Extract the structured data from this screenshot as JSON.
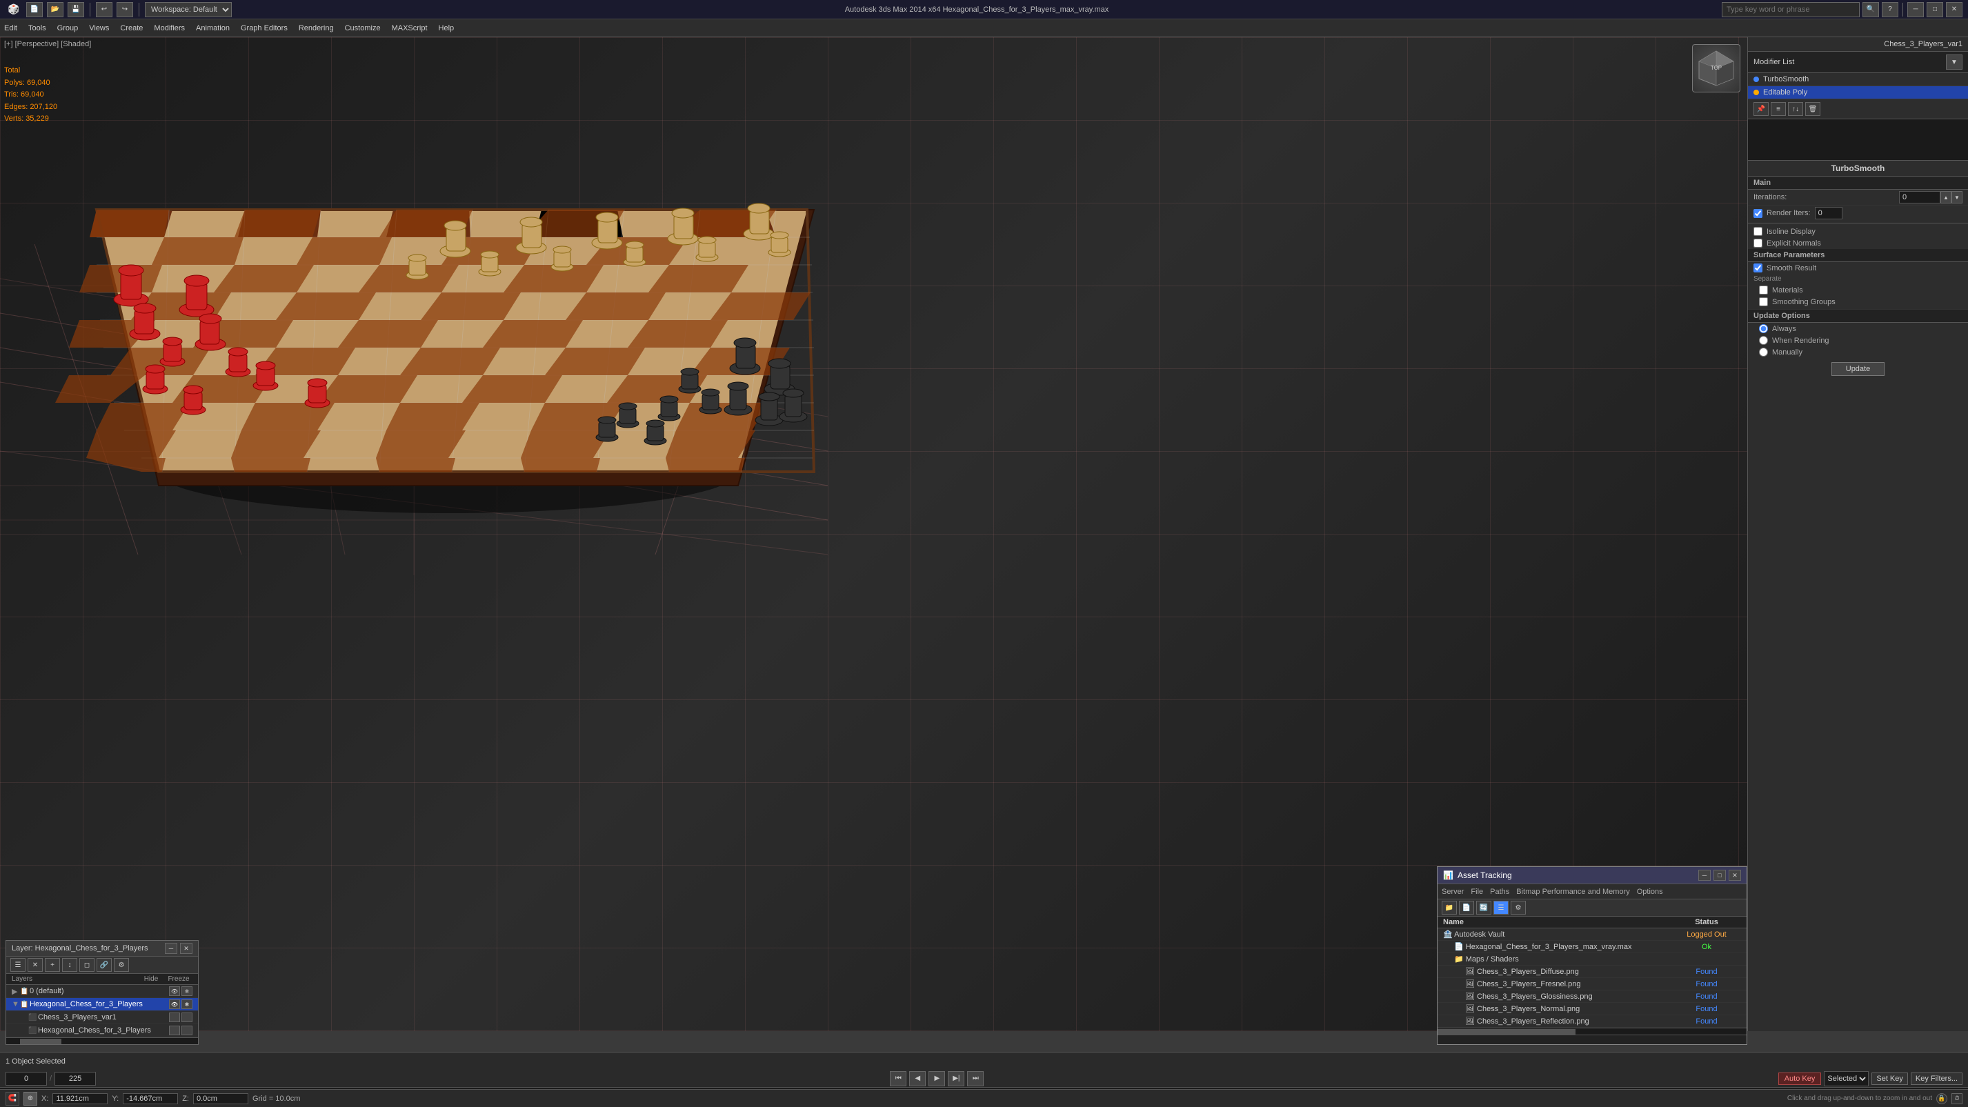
{
  "titlebar": {
    "app_icon": "3ds-max-icon",
    "title": "Autodesk 3ds Max 2014 x64   Hexagonal_Chess_for_3_Players_max_vray.max",
    "minimize": "─",
    "maximize": "□",
    "close": "✕",
    "workspace_label": "Workspace: Default"
  },
  "menubar": {
    "items": [
      "Edit",
      "Tools",
      "Group",
      "Views",
      "Create",
      "Modifiers",
      "Animation",
      "Graph Editors",
      "Rendering",
      "Customize",
      "MAXScript",
      "Help"
    ]
  },
  "search": {
    "placeholder": "Type key word or phrase"
  },
  "viewport": {
    "label": "[+] [Perspective] [Shaded]",
    "stats": {
      "total_label": "Total",
      "polys_label": "Polys:",
      "polys_value": "69,040",
      "tris_label": "Tris:",
      "tris_value": "69,040",
      "edges_label": "Edges:",
      "edges_value": "207,120",
      "verts_label": "Verts:",
      "verts_value": "35,229"
    }
  },
  "right_panel": {
    "object_name": "Chess_3_Players_var1",
    "modifier_list_label": "Modifier List",
    "modifiers": [
      {
        "name": "TurboSmooth",
        "color": "blue"
      },
      {
        "name": "Editable Poly",
        "color": "yellow"
      }
    ],
    "turbosmooth": {
      "title": "TurboSmooth",
      "main_label": "Main",
      "iterations_label": "Iterations:",
      "iterations_value": "0",
      "render_iters_label": "Render Iters:",
      "render_iters_checked": true,
      "isoline_display_label": "Isoline Display",
      "isoline_display_checked": false,
      "explicit_normals_label": "Explicit Normals",
      "explicit_normals_checked": false,
      "surface_params_label": "Surface Parameters",
      "smooth_result_label": "Smooth Result",
      "smooth_result_checked": true,
      "separate_label": "Separate",
      "materials_label": "Materials",
      "materials_checked": false,
      "smoothing_groups_label": "Smoothing Groups",
      "smoothing_groups_checked": false,
      "update_options_label": "Update Options",
      "always_label": "Always",
      "always_checked": true,
      "when_rendering_label": "When Rendering",
      "when_rendering_checked": false,
      "manually_label": "Manually",
      "manually_checked": false,
      "update_btn_label": "Update"
    }
  },
  "layer_panel": {
    "title": "Layer: Hexagonal_Chess_for_3_Players",
    "close_btn": "✕",
    "minimize_btn": "─",
    "col_hide": "Hide",
    "col_freeze": "Freeze",
    "layers": [
      {
        "name": "0 (default)",
        "level": 0,
        "selected": false,
        "icon": "layer"
      },
      {
        "name": "Hexagonal_Chess_for_3_Players",
        "level": 0,
        "selected": true,
        "icon": "layer"
      },
      {
        "name": "Chess_3_Players_var1",
        "level": 1,
        "selected": false,
        "icon": "object"
      },
      {
        "name": "Hexagonal_Chess_for_3_Players",
        "level": 1,
        "selected": false,
        "icon": "object"
      }
    ]
  },
  "asset_panel": {
    "title": "Asset Tracking",
    "close_btn": "✕",
    "minimize_btn": "─",
    "maximize_btn": "□",
    "menu_items": [
      "Server",
      "File",
      "Paths",
      "Bitmap Performance and Memory",
      "Options"
    ],
    "col_name": "Name",
    "col_status": "Status",
    "rows": [
      {
        "name": "Autodesk Vault",
        "level": 0,
        "status": "Logged Out",
        "status_type": "logged"
      },
      {
        "name": "Hexagonal_Chess_for_3_Players_max_vray.max",
        "level": 1,
        "status": "Ok",
        "status_type": "ok"
      },
      {
        "name": "Maps / Shaders",
        "level": 1,
        "status": "",
        "status_type": ""
      },
      {
        "name": "Chess_3_Players_Diffuse.png",
        "level": 2,
        "status": "Found",
        "status_type": "found"
      },
      {
        "name": "Chess_3_Players_Fresnel.png",
        "level": 2,
        "status": "Found",
        "status_type": "found"
      },
      {
        "name": "Chess_3_Players_Glossiness.png",
        "level": 2,
        "status": "Found",
        "status_type": "found"
      },
      {
        "name": "Chess_3_Players_Normal.png",
        "level": 2,
        "status": "Found",
        "status_type": "found"
      },
      {
        "name": "Chess_3_Players_Reflection.png",
        "level": 2,
        "status": "Found",
        "status_type": "found"
      }
    ]
  },
  "timeline": {
    "frame_current": "0",
    "frame_total": "225",
    "separator": "/"
  },
  "bottom_status": {
    "selected_text": "1 Object Selected",
    "click_hint": "Click and drag up-and-down to zoom in and out",
    "x_label": "X:",
    "x_value": "11.921cm",
    "y_label": "Y:",
    "y_value": "-14.667cm",
    "z_label": "Z:",
    "z_value": "0.0cm",
    "grid_label": "Grid = 10.0cm",
    "autokey_label": "Auto Key",
    "selected_dropdown": "Selected",
    "set_key_label": "Set Key",
    "key_filters_label": "Key Filters..."
  },
  "icons": {
    "search": "🔍",
    "layers": "📋",
    "folder": "📁",
    "file": "📄",
    "cube": "⬛",
    "arrow_right": "▶",
    "arrow_down": "▼",
    "close": "✕",
    "minimize": "─",
    "maximize": "□",
    "plus": "+",
    "minus": "−",
    "gear": "⚙",
    "play": "▶",
    "pause": "⏸",
    "stop": "⏹",
    "prev": "⏮",
    "next": "⏭",
    "key": "🔑"
  }
}
